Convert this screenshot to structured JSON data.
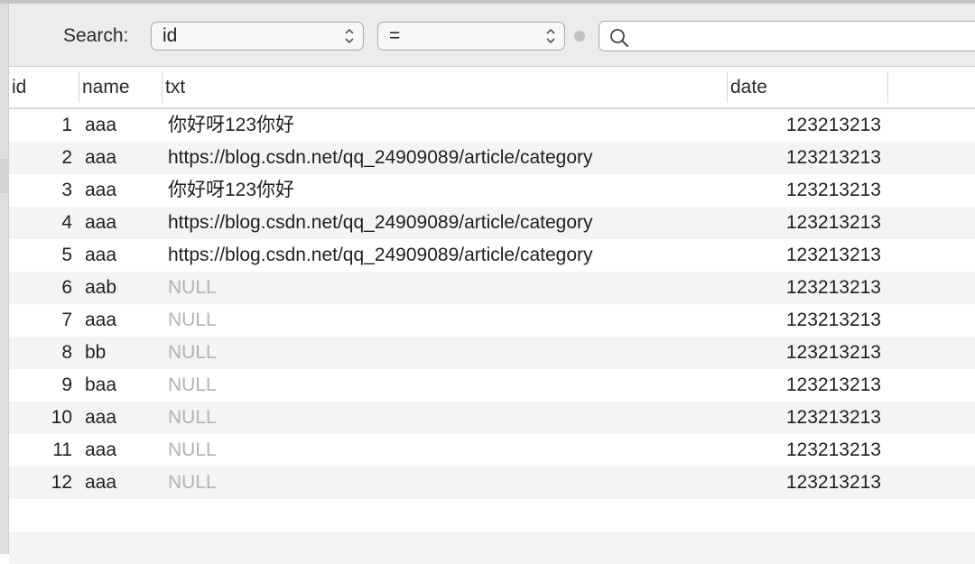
{
  "search": {
    "label": "Search:",
    "field": "id",
    "operator": "=",
    "value": "",
    "placeholder": ""
  },
  "columns": [
    "id",
    "name",
    "txt",
    "date"
  ],
  "rows": [
    {
      "id": "1",
      "name": "aaa",
      "txt": "你好呀123你好",
      "date": "123213213",
      "null": false
    },
    {
      "id": "2",
      "name": "aaa",
      "txt": "https://blog.csdn.net/qq_24909089/article/category",
      "date": "123213213",
      "null": false
    },
    {
      "id": "3",
      "name": "aaa",
      "txt": "你好呀123你好",
      "date": "123213213",
      "null": false
    },
    {
      "id": "4",
      "name": "aaa",
      "txt": "https://blog.csdn.net/qq_24909089/article/category",
      "date": "123213213",
      "null": false
    },
    {
      "id": "5",
      "name": "aaa",
      "txt": "https://blog.csdn.net/qq_24909089/article/category",
      "date": "123213213",
      "null": false
    },
    {
      "id": "6",
      "name": "aab",
      "txt": "NULL",
      "date": "123213213",
      "null": true
    },
    {
      "id": "7",
      "name": "aaa",
      "txt": "NULL",
      "date": "123213213",
      "null": true
    },
    {
      "id": "8",
      "name": "bb",
      "txt": "NULL",
      "date": "123213213",
      "null": true
    },
    {
      "id": "9",
      "name": "baa",
      "txt": "NULL",
      "date": "123213213",
      "null": true
    },
    {
      "id": "10",
      "name": "aaa",
      "txt": "NULL",
      "date": "123213213",
      "null": true
    },
    {
      "id": "11",
      "name": "aaa",
      "txt": "NULL",
      "date": "123213213",
      "null": true
    },
    {
      "id": "12",
      "name": "aaa",
      "txt": "NULL",
      "date": "123213213",
      "null": true
    }
  ],
  "colors": {
    "toolbar_bg": "#ececec",
    "row_alt": "#f4f4f4",
    "null_text": "#b3b3b3"
  }
}
